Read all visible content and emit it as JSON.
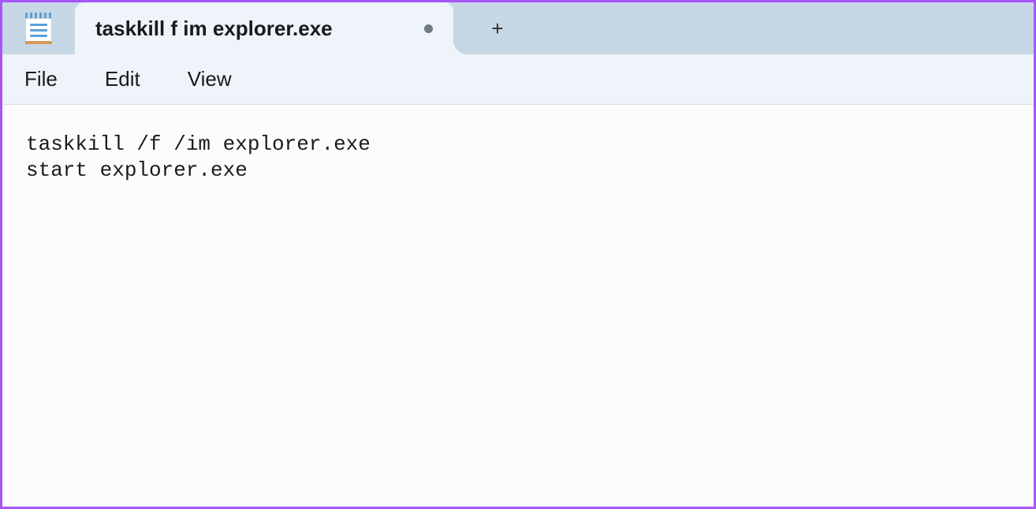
{
  "tab": {
    "title": "taskkill f im explorer.exe",
    "dirty": true
  },
  "menubar": {
    "items": [
      "File",
      "Edit",
      "View"
    ]
  },
  "editor": {
    "content": "taskkill /f /im explorer.exe\nstart explorer.exe"
  }
}
